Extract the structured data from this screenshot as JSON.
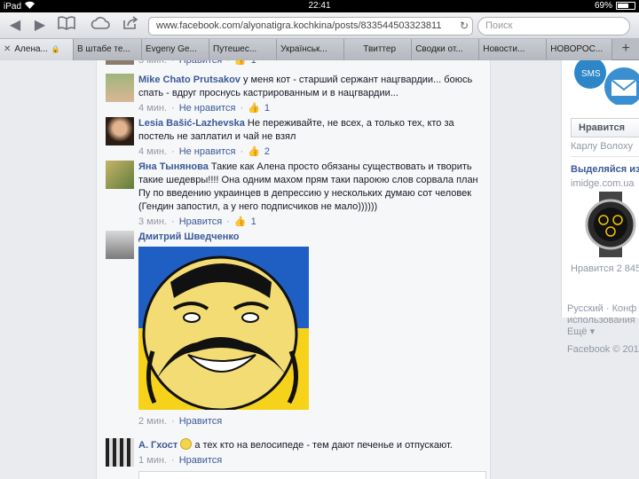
{
  "status_bar": {
    "device": "iPad",
    "time": "22:41",
    "battery": "69%",
    "battery_fraction": 0.69
  },
  "browser": {
    "url": "www.facebook.com/alyonatigra.kochkina/posts/833544503323811",
    "search_placeholder": "Поиск",
    "tabs": [
      {
        "label": "Алена...",
        "active": true,
        "lock": true
      },
      {
        "label": "В штабе те..."
      },
      {
        "label": "Evgeny Ge..."
      },
      {
        "label": "Путешес..."
      },
      {
        "label": "Українськ..."
      },
      {
        "label": "Твиттер"
      },
      {
        "label": "Сводки от..."
      },
      {
        "label": "Новости..."
      },
      {
        "label": "НОВОРОС..."
      }
    ],
    "new_tab": "+"
  },
  "comments": [
    {
      "author": "",
      "text": "",
      "time": "3 мин.",
      "action": "Нравится",
      "likes": "1"
    },
    {
      "author": "Mike Chato Prutsakov",
      "text": "у меня кот - старший сержант нацгвардии... боюсь спать - вдруг проснусь кастрированным и в нацгвардии...",
      "time": "4 мин.",
      "action": "Не нравится",
      "likes": "1"
    },
    {
      "author": "Lesia Bašić-Lazhevska",
      "text": "Не переживайте, не всех, а только тех, кто за постель не заплатил и чай не взял",
      "time": "4 мин.",
      "action": "Не нравится",
      "likes": "2"
    },
    {
      "author": "Яна Тынянова",
      "text": "Такие как Алена просто обязаны существовать и творить такие шедевры!!!! Она одним махом прям таки пароюю слов сорвала план Пу по введению украинцев в депрессию у нескольких думаю сот человек (Гендин запостил, а у него подписчиков не мало))))))",
      "time": "3 мин.",
      "action": "Нравится",
      "likes": "1"
    },
    {
      "author": "Дмитрий Шведченко",
      "text": "",
      "time": "2 мин.",
      "action": "Нравится",
      "likes": ""
    },
    {
      "author": "А. Гхост",
      "text": "а тех кто на велосипеде - тем дают печенье и отпускают.",
      "time": "1 мин.",
      "action": "Нравится",
      "likes": ""
    }
  ],
  "sidebar": {
    "like_button": "Нравится",
    "liked_by": "Карлу Волоху",
    "ad_title": "Выделяйся из",
    "ad_domain": "imidge.com.ua",
    "ad_likes": "Нравится 2 845",
    "footer": {
      "language": "Русский",
      "sep": "·",
      "privacy_part1": "Конф",
      "privacy_part2": "использования",
      "more": "Ещё",
      "copyright": "Facebook © 201"
    }
  },
  "colors": {
    "facebook_blue": "#3b5998",
    "page_bg": "#e9ebee",
    "flag_blue": "#1f5fc4",
    "flag_yellow": "#f6d21a"
  }
}
